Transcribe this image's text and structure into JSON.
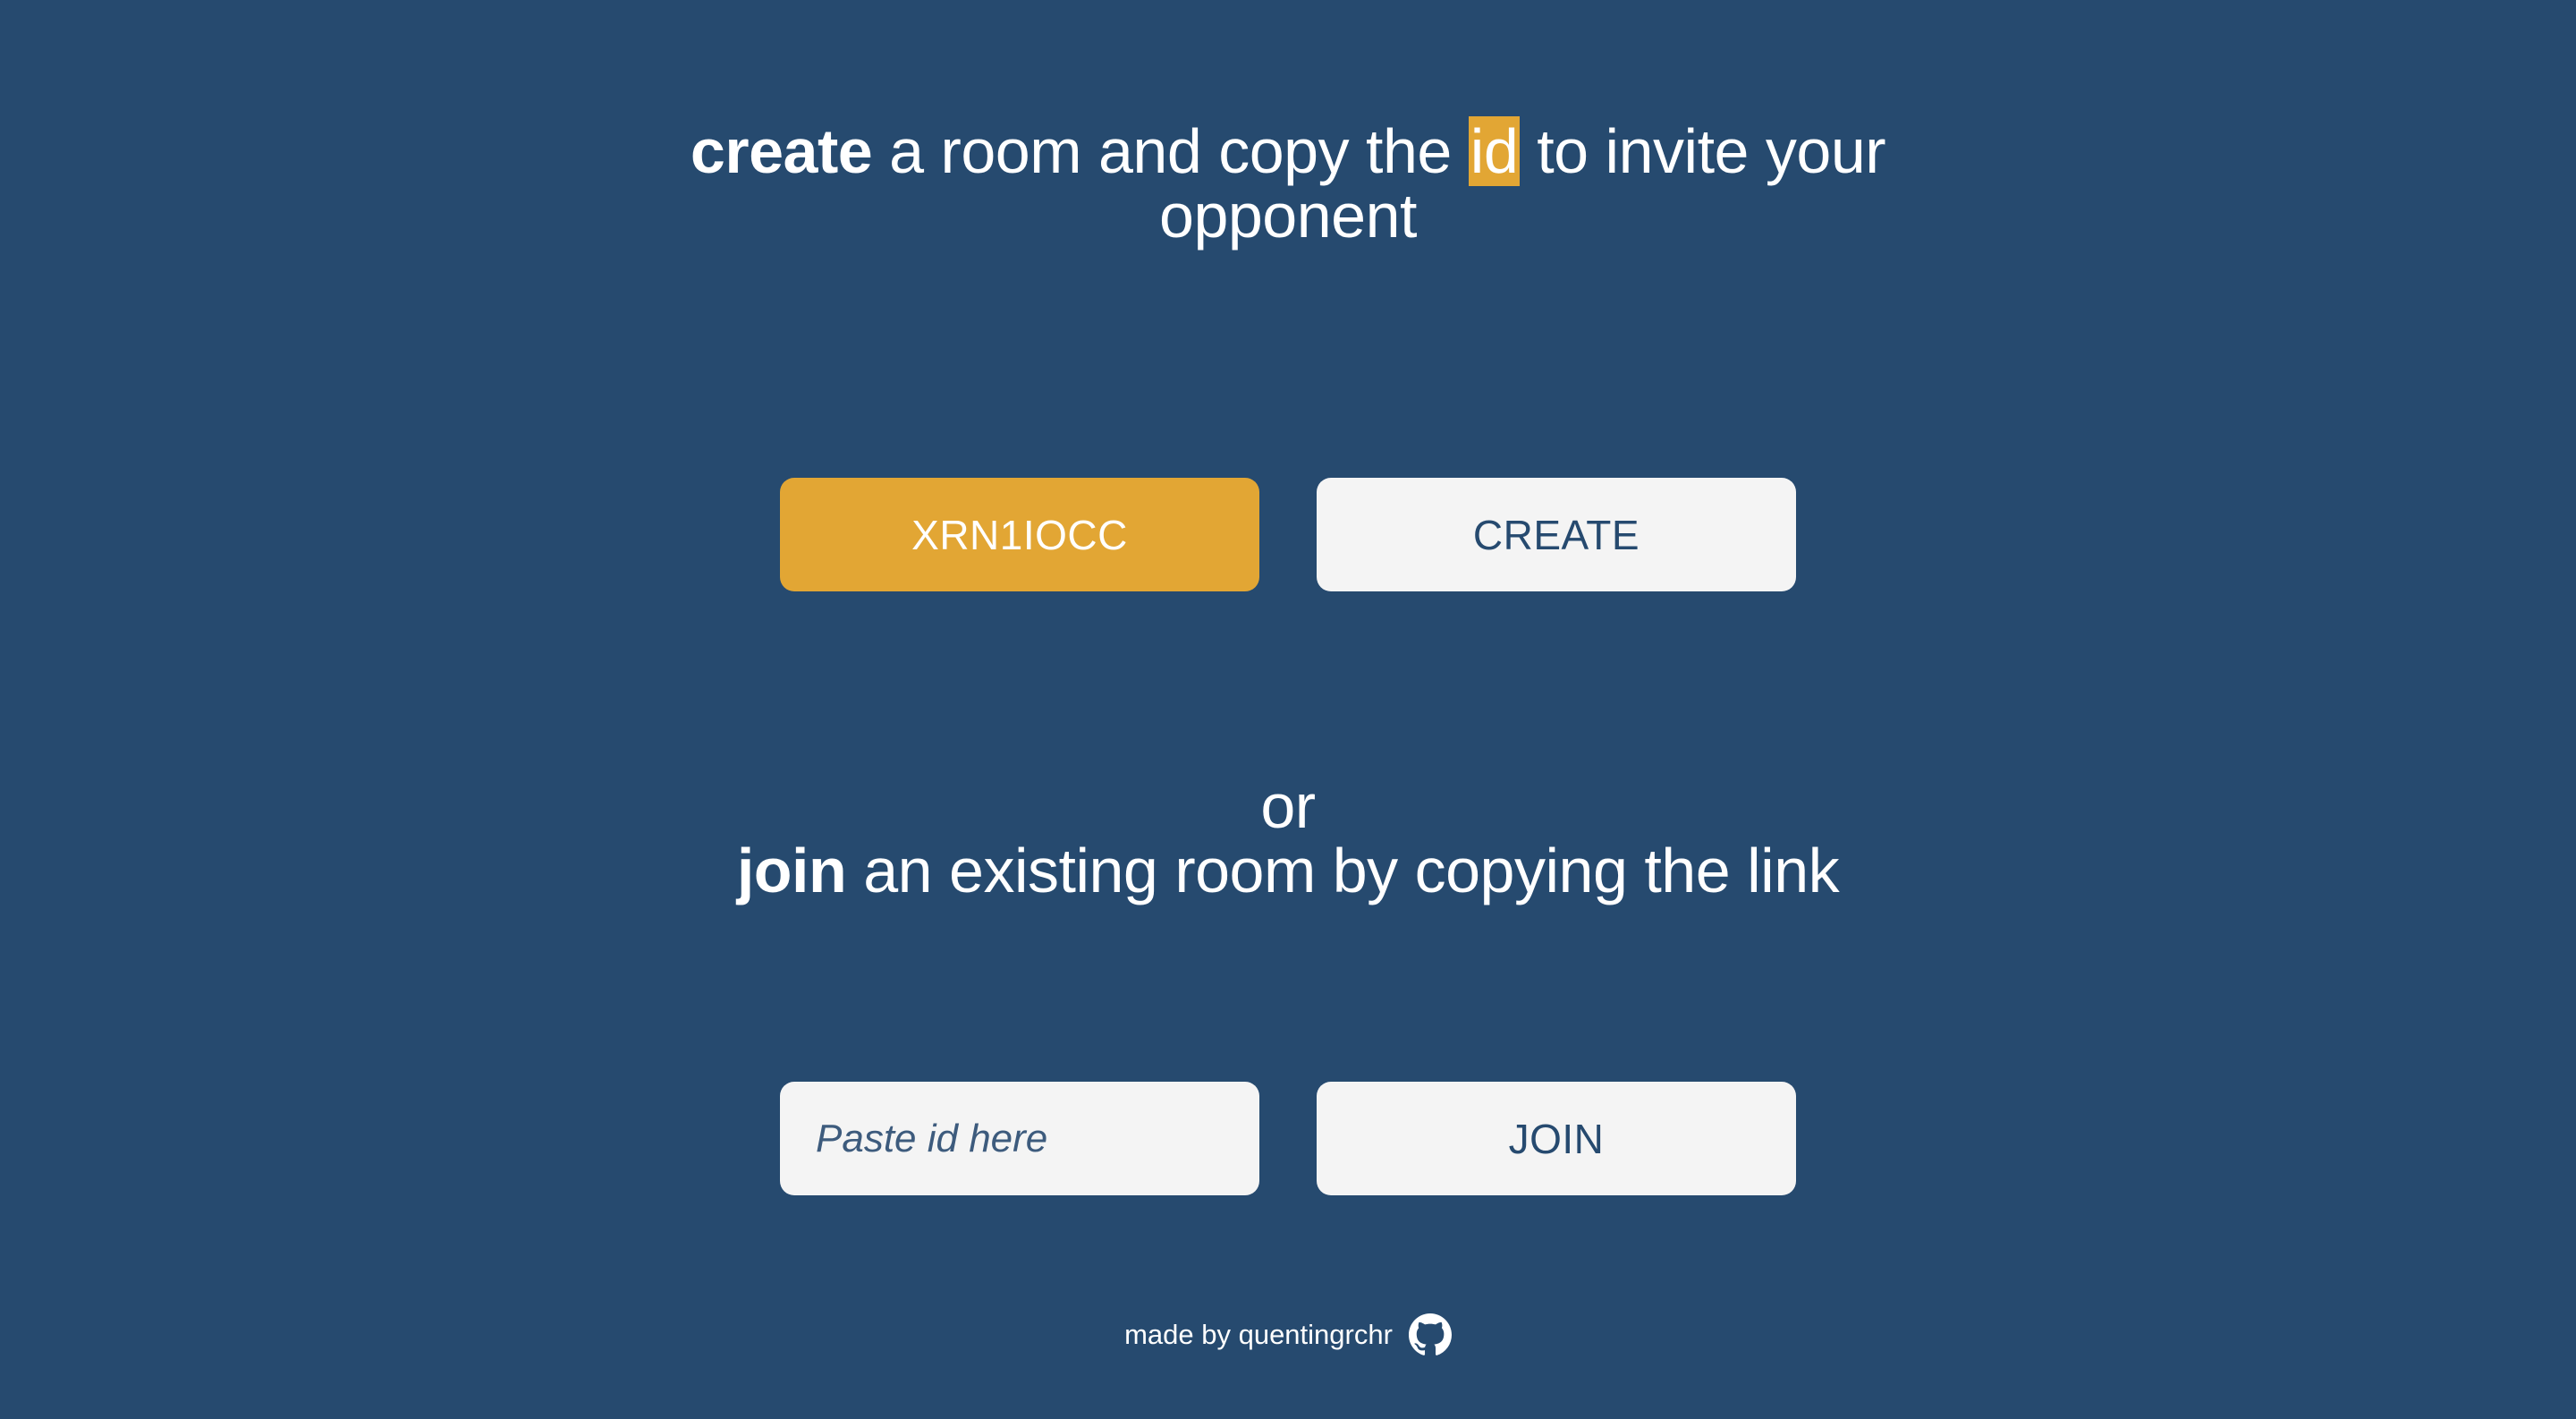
{
  "create_section": {
    "word_bold": "create",
    "text_before_id": " a room and copy the ",
    "highlight": "id",
    "text_after_id": " to invite your opponent"
  },
  "room_id_button": "XRN1IOCC",
  "create_button": "CREATE",
  "join_section": {
    "or_text": "or",
    "word_bold": "join",
    "text_rest": " an existing room by copying the link"
  },
  "join_input": {
    "placeholder": "Paste id here",
    "value": ""
  },
  "join_button": "JOIN",
  "footer": {
    "text": "made by quentingrchr",
    "icon": "github-icon"
  },
  "colors": {
    "background": "#264a6f",
    "accent": "#e2a634",
    "light": "#f4f4f4"
  }
}
